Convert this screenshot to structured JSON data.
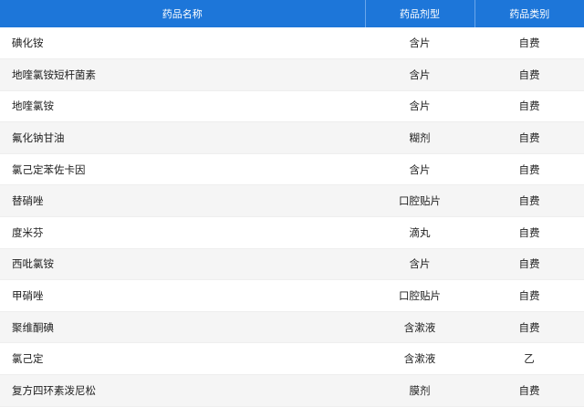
{
  "table": {
    "headers": [
      "药品名称",
      "药品剂型",
      "药品类别"
    ],
    "rows": [
      {
        "name": "碘化铵",
        "form": "含片",
        "category": "自费"
      },
      {
        "name": "地喹氯铵短杆菌素",
        "form": "含片",
        "category": "自费"
      },
      {
        "name": "地喹氯铵",
        "form": "含片",
        "category": "自费"
      },
      {
        "name": "氟化钠甘油",
        "form": "糊剂",
        "category": "自费"
      },
      {
        "name": "氯己定苯佐卡因",
        "form": "含片",
        "category": "自费"
      },
      {
        "name": "替硝唑",
        "form": "口腔贴片",
        "category": "自费"
      },
      {
        "name": "度米芬",
        "form": "滴丸",
        "category": "自费"
      },
      {
        "name": "西吡氯铵",
        "form": "含片",
        "category": "自费"
      },
      {
        "name": "甲硝唑",
        "form": "口腔贴片",
        "category": "自费"
      },
      {
        "name": "聚维酮碘",
        "form": "含漱液",
        "category": "自费"
      },
      {
        "name": "氯己定",
        "form": "含漱液",
        "category": "乙"
      },
      {
        "name": "复方四环素泼尼松",
        "form": "膜剂",
        "category": "自费"
      }
    ]
  }
}
